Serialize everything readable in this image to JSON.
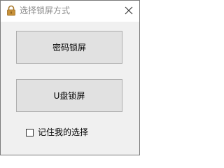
{
  "window": {
    "title": "选择锁屏方式",
    "app_icon": "padlock-icon",
    "close_icon": "close-icon"
  },
  "buttons": {
    "password_lock": "密码锁屏",
    "usb_lock": "U盘锁屏"
  },
  "remember_choice": {
    "label": "记住我的选择",
    "checked": false
  },
  "colors": {
    "title_text": "#8c8c8c",
    "client_bg": "#f0f0f0",
    "button_bg": "#e1e1e1",
    "button_border": "#adadad",
    "icon_gold": "#c8923a"
  }
}
